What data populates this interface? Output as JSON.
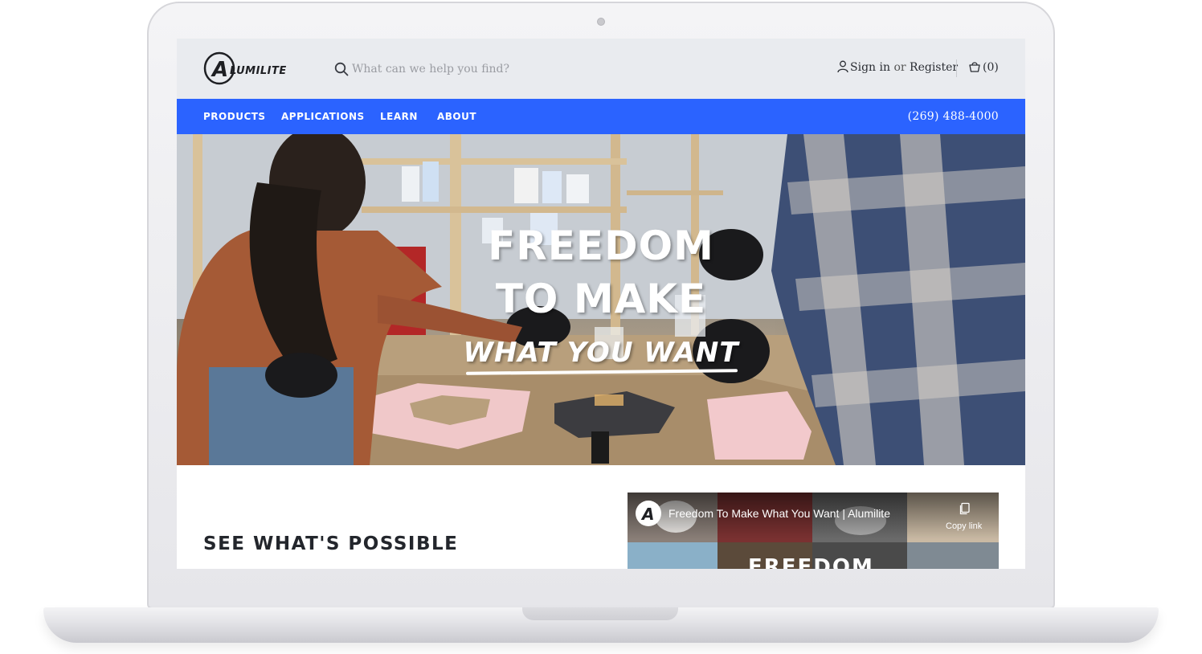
{
  "header": {
    "logo_text": "ALUMILITE",
    "search_placeholder": "What can we help you find?",
    "sign_in": "Sign in",
    "or": "or",
    "register": "Register",
    "cart_count": "(0)",
    "icons": [
      "search-icon",
      "user-icon",
      "cart-icon"
    ]
  },
  "nav": {
    "items": [
      {
        "label": "PRODUCTS"
      },
      {
        "label": "APPLICATIONS"
      },
      {
        "label": "LEARN"
      },
      {
        "label": "ABOUT"
      }
    ],
    "phone": "(269) 488-4000",
    "color": "#2b63ff"
  },
  "hero": {
    "line1": "FREEDOM",
    "line2": "TO MAKE",
    "line3": "WHAT YOU WANT"
  },
  "section": {
    "title": "SEE WHAT'S POSSIBLE"
  },
  "video": {
    "title": "Freedom To Make What You Want | Alumilite",
    "copy_label": "Copy link",
    "overlay_word": "FREEDOM"
  }
}
